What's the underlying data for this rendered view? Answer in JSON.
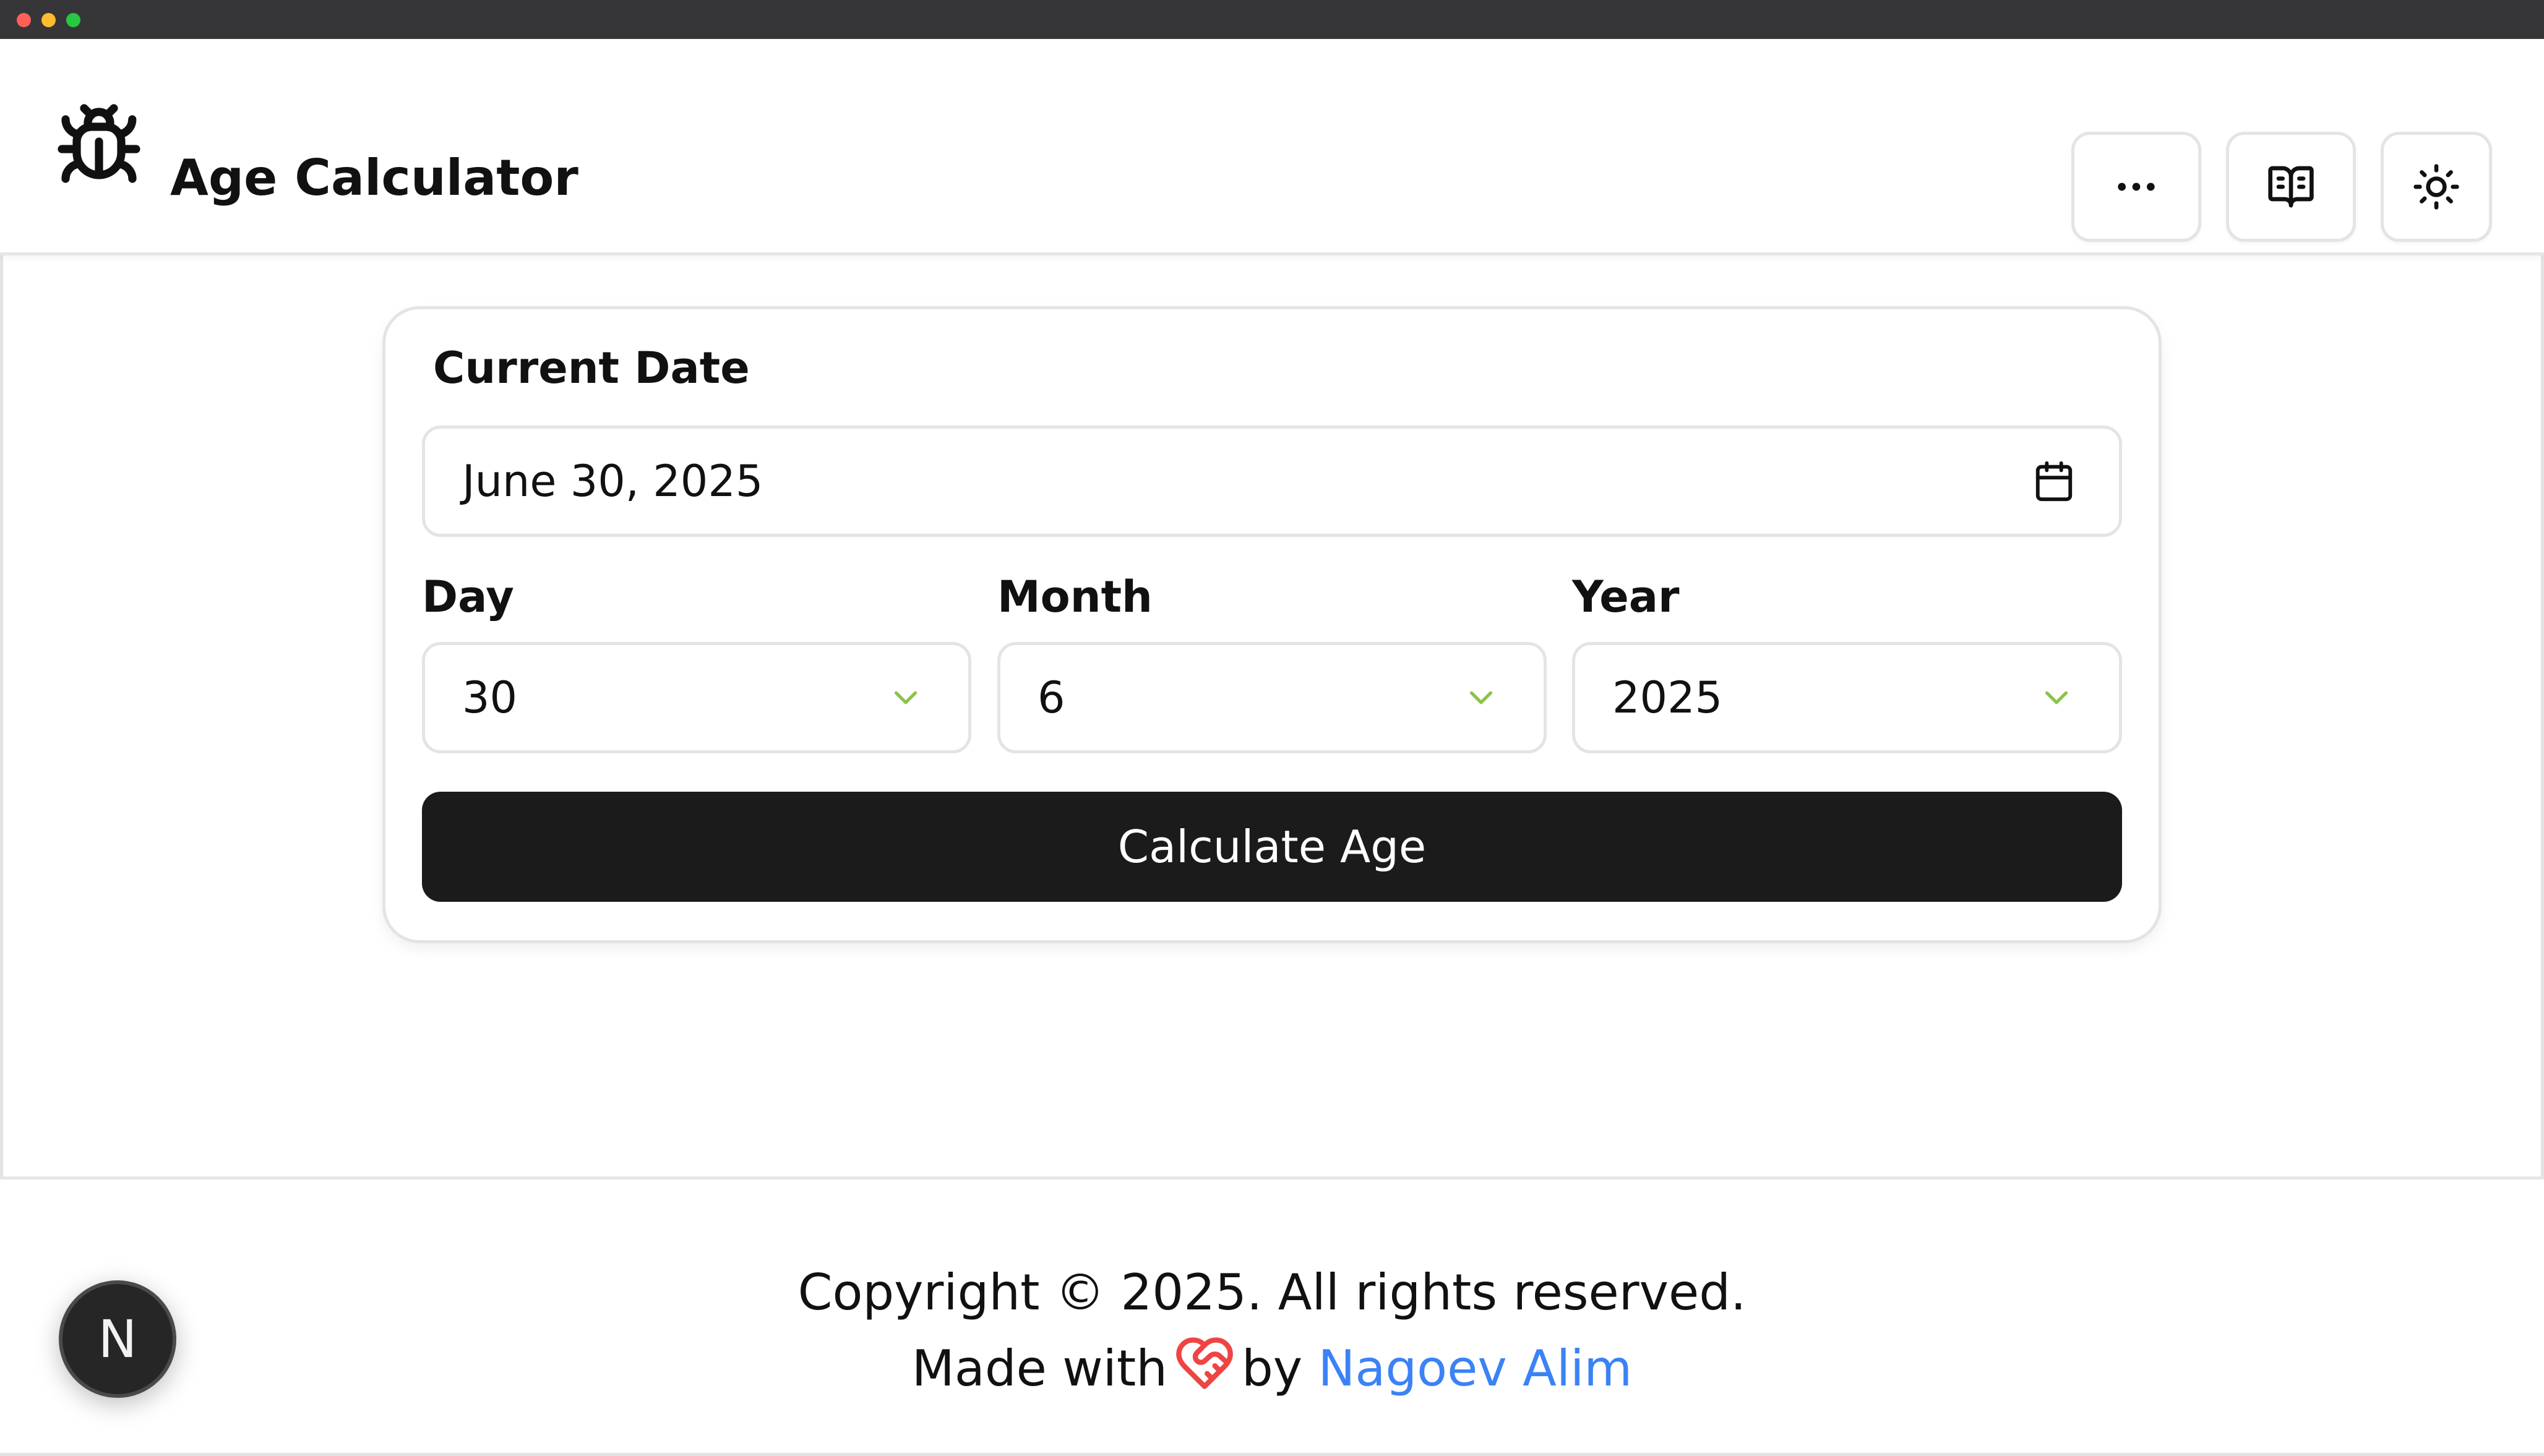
{
  "window": {
    "controls": [
      "close",
      "minimize",
      "maximize"
    ],
    "colors": {
      "close": "#ff5f57",
      "minimize": "#febc2e",
      "maximize": "#28c840"
    }
  },
  "header": {
    "title": "Age Calculator",
    "logo_icon": "bug-icon",
    "buttons": [
      {
        "icon": "ellipsis-icon"
      },
      {
        "icon": "book-open-icon"
      },
      {
        "icon": "sun-icon"
      }
    ]
  },
  "form": {
    "current_date_label": "Current Date",
    "current_date_value": "June 30, 2025",
    "day": {
      "label": "Day",
      "value": "30"
    },
    "month": {
      "label": "Month",
      "value": "6"
    },
    "year": {
      "label": "Year",
      "value": "2025"
    },
    "submit_label": "Calculate Age"
  },
  "footer": {
    "copyright": "Copyright © 2025. All rights reserved.",
    "made_with": "Made with",
    "by": "by",
    "author": "Nagoev Alim",
    "heart_icon": "heart-handshake-icon"
  },
  "badge": {
    "letter": "N"
  },
  "colors": {
    "chevron": "#8bc34a",
    "link": "#3b82f6",
    "heart": "#ef4444",
    "button_bg": "#1b1b1b"
  }
}
